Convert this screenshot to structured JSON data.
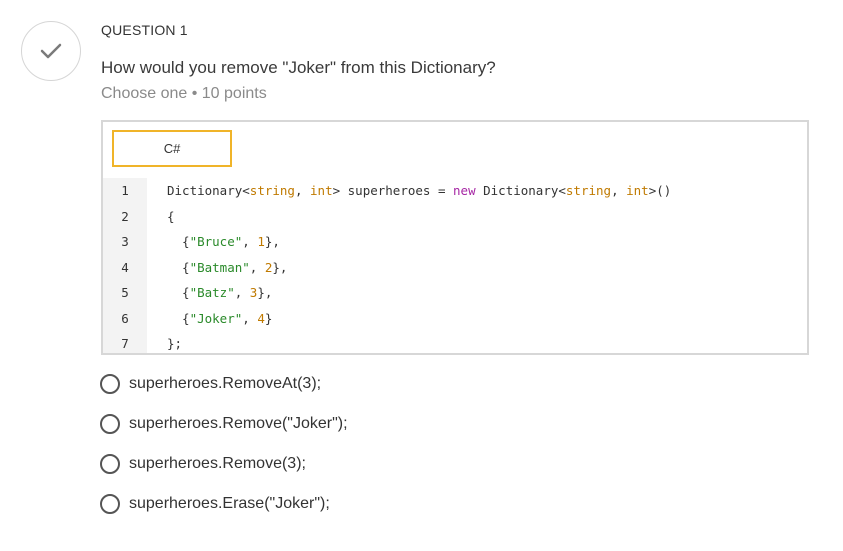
{
  "question": {
    "label": "QUESTION 1",
    "text": "How would you remove \"Joker\" from this Dictionary?",
    "meta": "Choose one • 10 points",
    "status_icon": "checkmark-icon"
  },
  "code": {
    "language": "C#",
    "lines": [
      {
        "num": "1",
        "parts": [
          [
            "",
            "Dictionary<"
          ],
          [
            "p",
            "string"
          ],
          [
            "",
            ", "
          ],
          [
            "p",
            "int"
          ],
          [
            "",
            "> superheroes = "
          ],
          [
            "k",
            "new"
          ],
          [
            "",
            " Dictionary<"
          ],
          [
            "p",
            "string"
          ],
          [
            "",
            ", "
          ],
          [
            "p",
            "int"
          ],
          [
            "",
            ">()"
          ]
        ]
      },
      {
        "num": "2",
        "parts": [
          [
            "",
            "{"
          ]
        ]
      },
      {
        "num": "3",
        "parts": [
          [
            "",
            "  {"
          ],
          [
            "s",
            "\"Bruce\""
          ],
          [
            "",
            ", "
          ],
          [
            "n",
            "1"
          ],
          [
            "",
            "},"
          ]
        ]
      },
      {
        "num": "4",
        "parts": [
          [
            "",
            "  {"
          ],
          [
            "s",
            "\"Batman\""
          ],
          [
            "",
            ", "
          ],
          [
            "n",
            "2"
          ],
          [
            "",
            "},"
          ]
        ]
      },
      {
        "num": "5",
        "parts": [
          [
            "",
            "  {"
          ],
          [
            "s",
            "\"Batz\""
          ],
          [
            "",
            ", "
          ],
          [
            "n",
            "3"
          ],
          [
            "",
            "},"
          ]
        ]
      },
      {
        "num": "6",
        "parts": [
          [
            "",
            "  {"
          ],
          [
            "s",
            "\"Joker\""
          ],
          [
            "",
            ", "
          ],
          [
            "n",
            "4"
          ],
          [
            "",
            "}"
          ]
        ]
      },
      {
        "num": "7",
        "parts": [
          [
            "",
            "};"
          ]
        ]
      }
    ]
  },
  "options": [
    {
      "label": "superheroes.RemoveAt(3);"
    },
    {
      "label": "superheroes.Remove(\"Joker\");"
    },
    {
      "label": "superheroes.Remove(3);"
    },
    {
      "label": "superheroes.Erase(\"Joker\");"
    }
  ],
  "colors": {
    "accent_tab_border": "#f0b429",
    "keyword": "#a626a4",
    "string": "#2a8a2a",
    "number": "#c07a00"
  }
}
